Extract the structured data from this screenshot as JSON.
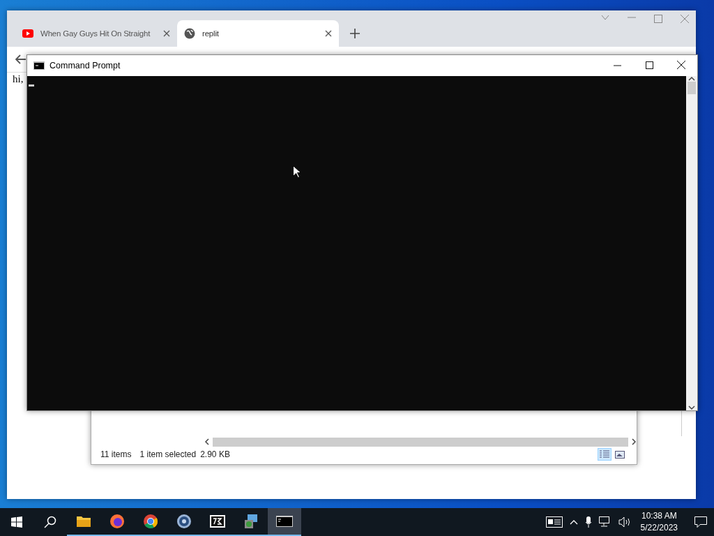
{
  "browser": {
    "tabs": [
      {
        "kind": "video",
        "title": "When Gay Guys Hit On Straight",
        "selected": false
      },
      {
        "kind": "globe",
        "title": "replit",
        "selected": true
      }
    ],
    "page_text": "hi,"
  },
  "explorer": {
    "status": [
      "11 items",
      "1 item selected",
      "2.90 KB"
    ],
    "views": [
      {
        "kind": "details",
        "selected": true
      },
      {
        "kind": "preview",
        "selected": false
      }
    ]
  },
  "console": {
    "title": "Command Prompt"
  },
  "taskbar": {
    "apps": [
      {
        "kind": "folder",
        "running": true,
        "selected": false
      },
      {
        "kind": "firefox",
        "running": true,
        "selected": false
      },
      {
        "kind": "chrome",
        "running": true,
        "selected": false
      },
      {
        "kind": "disc",
        "running": true,
        "selected": false
      },
      {
        "kind": "archive",
        "running": true,
        "selected": false
      },
      {
        "kind": "installer",
        "running": true,
        "selected": false
      },
      {
        "kind": "console",
        "running": true,
        "selected": true
      }
    ],
    "time": "10:38 AM",
    "date": "5/22/2023"
  }
}
